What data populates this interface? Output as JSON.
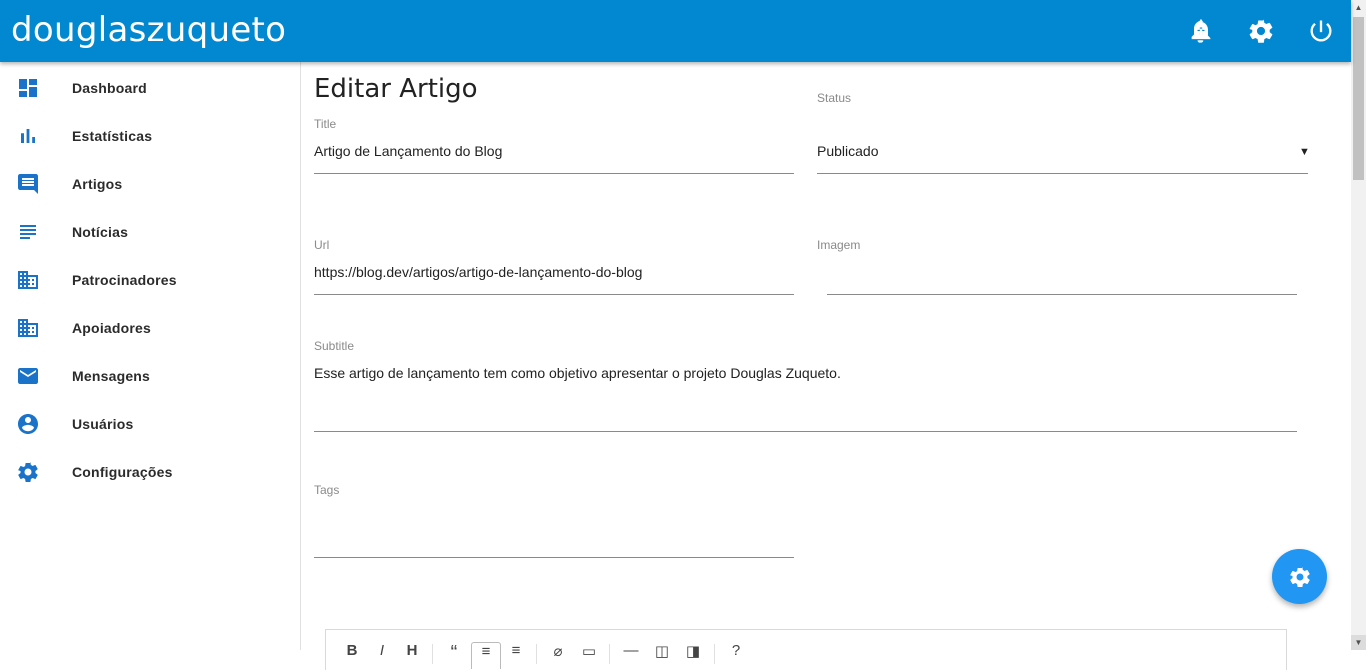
{
  "app": {
    "brand": "douglaszuqueto"
  },
  "header_icons": [
    "notification-add-icon",
    "settings-icon",
    "power-icon"
  ],
  "sidebar": {
    "items": [
      {
        "label": "Dashboard",
        "icon": "dashboard-icon"
      },
      {
        "label": "Estatísticas",
        "icon": "bar-chart-icon"
      },
      {
        "label": "Artigos",
        "icon": "comment-icon"
      },
      {
        "label": "Notícias",
        "icon": "subject-icon"
      },
      {
        "label": "Patrocinadores",
        "icon": "business-icon"
      },
      {
        "label": "Apoiadores",
        "icon": "business-icon"
      },
      {
        "label": "Mensagens",
        "icon": "email-icon"
      },
      {
        "label": "Usuários",
        "icon": "account-circle-icon"
      },
      {
        "label": "Configurações",
        "icon": "settings-icon"
      }
    ]
  },
  "form": {
    "title": "Editar Artigo",
    "title_field": {
      "label": "Title",
      "value": "Artigo de Lançamento do Blog"
    },
    "status_field": {
      "label": "Status",
      "value": "Publicado"
    },
    "url_field": {
      "label": "Url",
      "value": "https://blog.dev/artigos/artigo-de-lançamento-do-blog"
    },
    "image_field": {
      "label": "Imagem",
      "value": ""
    },
    "subtitle_field": {
      "label": "Subtitle",
      "value": "Esse artigo de lançamento tem como objetivo apresentar o projeto Douglas Zuqueto."
    },
    "tags_field": {
      "label": "Tags",
      "value": ""
    }
  },
  "editor_toolbar": {
    "buttons": [
      "B",
      "I",
      "H",
      "“",
      "≡",
      "≡",
      "⌀",
      "▭",
      "—",
      "◫",
      "◨",
      "?"
    ]
  },
  "colors": {
    "primary": "#0288d1",
    "fab": "#2196f3",
    "nav_icon": "#1a73c8"
  }
}
